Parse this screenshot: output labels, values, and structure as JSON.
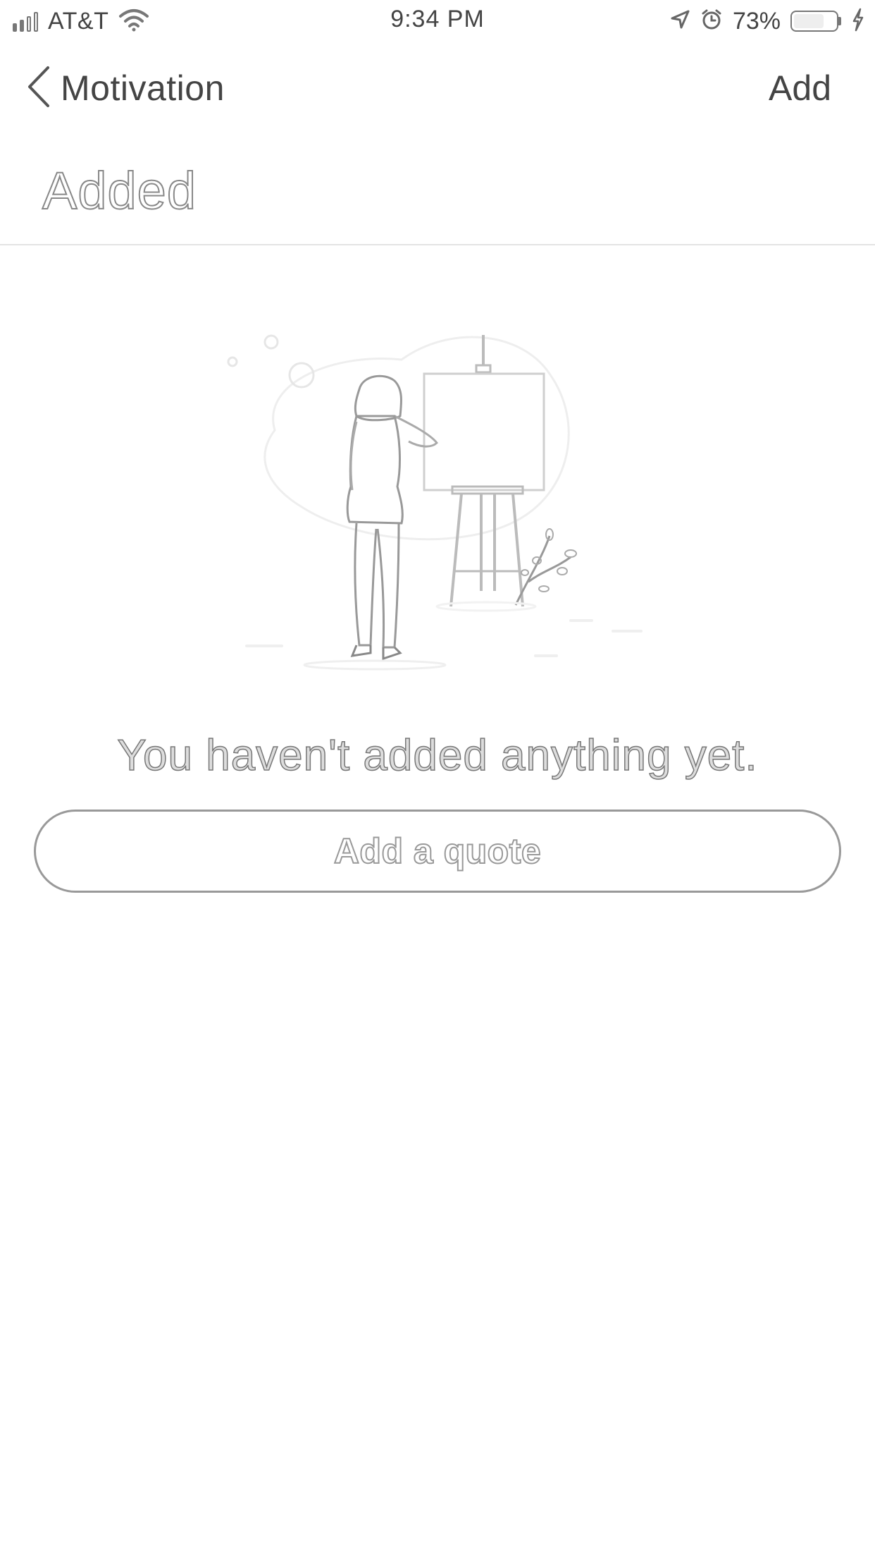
{
  "status_bar": {
    "carrier": "AT&T",
    "time": "9:34 PM",
    "battery_percent": "73%",
    "signal_bars_filled": 2,
    "signal_bars_total": 4,
    "battery_level": 0.73,
    "icons": [
      "signal-icon",
      "wifi-icon",
      "location-arrow-icon",
      "alarm-icon",
      "battery-icon",
      "charging-bolt-icon"
    ]
  },
  "nav": {
    "back_label": "Motivation",
    "back_icon": "chevron-left-icon",
    "action_label": "Add"
  },
  "page": {
    "title": "Added"
  },
  "empty_state": {
    "illustration": "woman-at-easel-illustration",
    "message": "You haven't added anything yet.",
    "button_label": "Add a quote"
  },
  "colors": {
    "background": "#ffffff",
    "text": "#444444",
    "outline": "#999999",
    "divider": "#e3e3e3"
  }
}
